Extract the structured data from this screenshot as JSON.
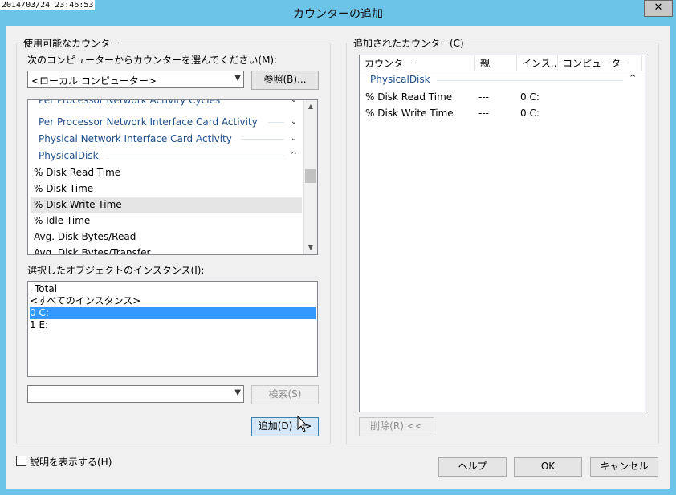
{
  "window": {
    "title": "カウンターの追加",
    "timestamp": "2014/03/24 23:46:53",
    "close_glyph": "✕"
  },
  "available": {
    "group_label": "使用可能なカウンター",
    "select_label": "次のコンピューターからカウンターを選んでください(M):",
    "computer_value": "<ローカル コンピューター>",
    "browse_label": "参照(B)...",
    "counters": [
      {
        "label": "Per Processor Network Activity Cycles",
        "type": "category",
        "expanded": false
      },
      {
        "label": "Per Processor Network Interface Card Activity",
        "type": "category",
        "expanded": false
      },
      {
        "label": "Physical Network Interface Card Activity",
        "type": "category",
        "expanded": false
      },
      {
        "label": "PhysicalDisk",
        "type": "category",
        "expanded": true
      },
      {
        "label": "% Disk Read Time",
        "type": "counter"
      },
      {
        "label": "% Disk Time",
        "type": "counter"
      },
      {
        "label": "% Disk Write Time",
        "type": "counter",
        "highlighted": true
      },
      {
        "label": "% Idle Time",
        "type": "counter"
      },
      {
        "label": "Avg. Disk Bytes/Read",
        "type": "counter"
      },
      {
        "label": "Avg. Disk Bytes/Transfer",
        "type": "counter"
      }
    ],
    "instances_label": "選択したオブジェクトのインスタンス(I):",
    "instances": [
      {
        "label": "_Total",
        "selected": false
      },
      {
        "label": "<すべてのインスタンス>",
        "selected": false
      },
      {
        "label": "0 C:",
        "selected": true
      },
      {
        "label": "1 E:",
        "selected": false
      }
    ],
    "search_value": "",
    "search_label": "検索(S)",
    "add_label": "追加(D) >>"
  },
  "added": {
    "group_label": "追加されたカウンター(C)",
    "columns": [
      "カウンター",
      "親",
      "インス...",
      "コンピューター"
    ],
    "category": "PhysicalDisk",
    "rows": [
      {
        "counter": "% Disk Read Time",
        "parent": "---",
        "instance": "0 C:",
        "computer": ""
      },
      {
        "counter": "% Disk Write Time",
        "parent": "---",
        "instance": "0 C:",
        "computer": ""
      }
    ],
    "remove_label": "削除(R) <<"
  },
  "footer": {
    "show_desc_label": "説明を表示する(H)",
    "show_desc_checked": false,
    "help_label": "ヘルプ",
    "ok_label": "OK",
    "cancel_label": "キャンセル"
  },
  "icons": {
    "chevron_down": "⌄",
    "chevron_up": "^",
    "combo_arrow": "▼",
    "scroll_up": "▲",
    "scroll_down": "▼"
  },
  "colors": {
    "titlebar": "#6cc4e8",
    "selection": "#3399ff",
    "category_text": "#1e4e8a"
  }
}
